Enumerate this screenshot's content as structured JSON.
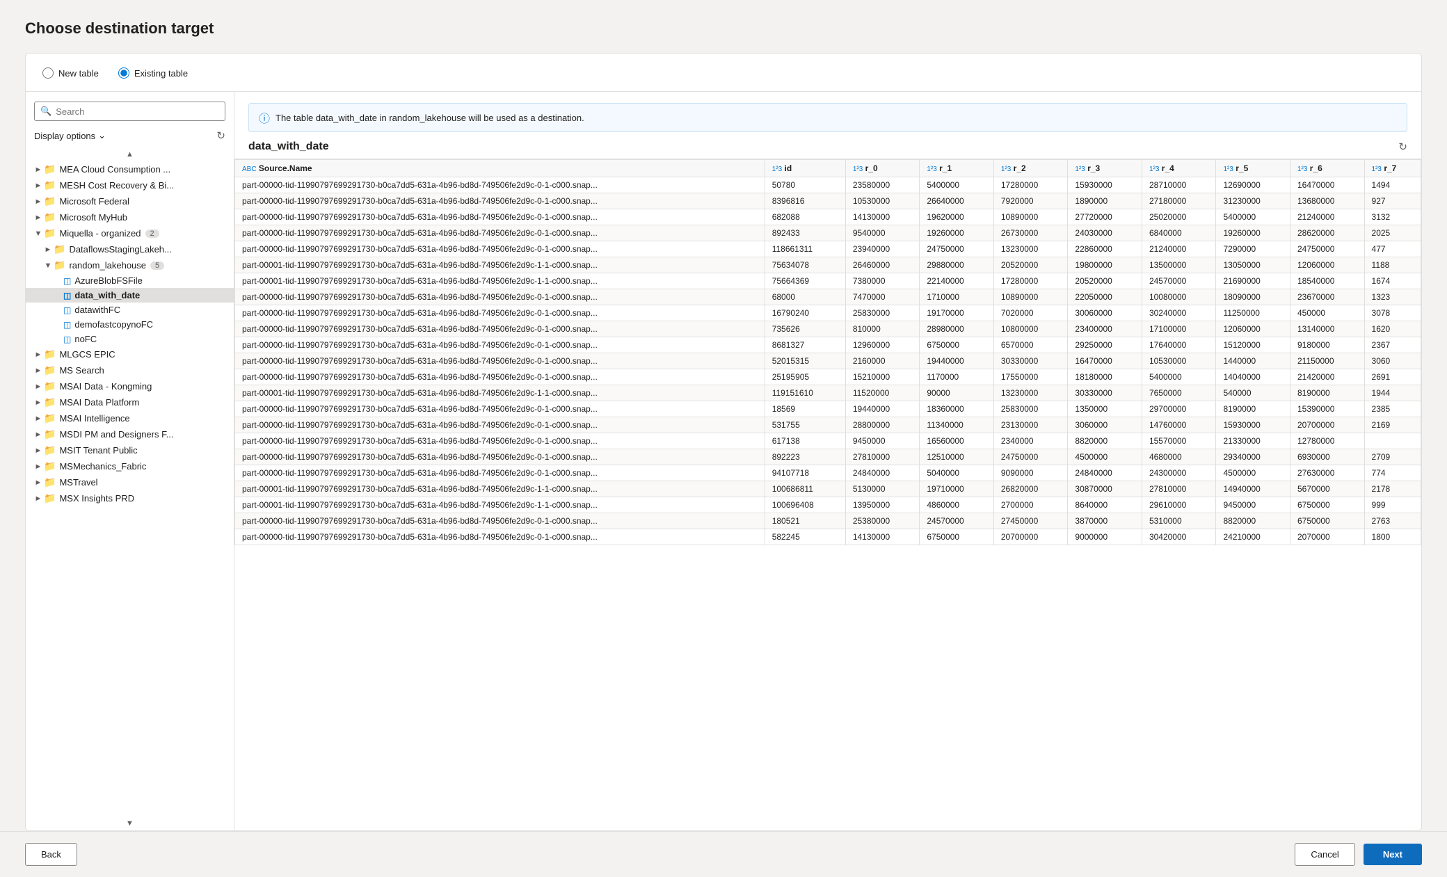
{
  "page": {
    "title": "Choose destination target"
  },
  "options": {
    "new_table_label": "New table",
    "existing_table_label": "Existing table"
  },
  "left": {
    "search_placeholder": "Search",
    "display_options_label": "Display options",
    "tree": [
      {
        "id": "mea",
        "label": "MEA Cloud Consumption ...",
        "level": 1,
        "type": "folder",
        "expanded": false,
        "badge": ""
      },
      {
        "id": "mesh",
        "label": "MESH Cost Recovery & Bi...",
        "level": 1,
        "type": "folder",
        "expanded": false,
        "badge": ""
      },
      {
        "id": "msfederal",
        "label": "Microsoft Federal",
        "level": 1,
        "type": "folder",
        "expanded": false,
        "badge": ""
      },
      {
        "id": "mymyhub",
        "label": "Microsoft MyHub",
        "level": 1,
        "type": "folder",
        "expanded": false,
        "badge": ""
      },
      {
        "id": "miquellaorg",
        "label": "Miquella - organized",
        "level": 1,
        "type": "folder",
        "expanded": true,
        "badge": "2"
      },
      {
        "id": "dataflows",
        "label": "DataflowsStagingLakeh...",
        "level": 2,
        "type": "folder",
        "expanded": false,
        "badge": ""
      },
      {
        "id": "randomlake",
        "label": "random_lakehouse",
        "level": 2,
        "type": "folder",
        "expanded": true,
        "badge": "5"
      },
      {
        "id": "azureblob",
        "label": "AzureBlobFSFile",
        "level": 3,
        "type": "table",
        "expanded": false,
        "badge": ""
      },
      {
        "id": "datawithdate",
        "label": "data_with_date",
        "level": 3,
        "type": "table",
        "expanded": false,
        "badge": "",
        "selected": true
      },
      {
        "id": "datawithfc",
        "label": "datawithFC",
        "level": 3,
        "type": "table",
        "expanded": false,
        "badge": ""
      },
      {
        "id": "demofastcopy",
        "label": "demofastcopynoFC",
        "level": 3,
        "type": "table",
        "expanded": false,
        "badge": ""
      },
      {
        "id": "nofc",
        "label": "noFC",
        "level": 3,
        "type": "table",
        "expanded": false,
        "badge": ""
      },
      {
        "id": "mlgcs",
        "label": "MLGCS EPIC",
        "level": 1,
        "type": "folder",
        "expanded": false,
        "badge": ""
      },
      {
        "id": "mssearch",
        "label": "MS Search",
        "level": 1,
        "type": "folder",
        "expanded": false,
        "badge": ""
      },
      {
        "id": "msaikongming",
        "label": "MSAI Data - Kongming",
        "level": 1,
        "type": "folder",
        "expanded": false,
        "badge": ""
      },
      {
        "id": "msaidataplatform",
        "label": "MSAI Data Platform",
        "level": 1,
        "type": "folder",
        "expanded": false,
        "badge": ""
      },
      {
        "id": "msaiintelligence",
        "label": "MSAI Intelligence",
        "level": 1,
        "type": "folder",
        "expanded": false,
        "badge": ""
      },
      {
        "id": "msdipm",
        "label": "MSDI PM and Designers F...",
        "level": 1,
        "type": "folder",
        "expanded": false,
        "badge": ""
      },
      {
        "id": "msittenant",
        "label": "MSIT Tenant Public",
        "level": 1,
        "type": "folder",
        "expanded": false,
        "badge": ""
      },
      {
        "id": "msmechanics",
        "label": "MSMechanics_Fabric",
        "level": 1,
        "type": "folder",
        "expanded": false,
        "badge": ""
      },
      {
        "id": "mstravel",
        "label": "MSTravel",
        "level": 1,
        "type": "folder",
        "expanded": false,
        "badge": ""
      },
      {
        "id": "msxinsights",
        "label": "MSX Insights PRD",
        "level": 1,
        "type": "folder",
        "expanded": false,
        "badge": ""
      }
    ]
  },
  "right": {
    "info_text": "The table data_with_date in random_lakehouse will be used as a destination.",
    "table_name": "data_with_date",
    "columns": [
      {
        "name": "Source.Name",
        "type": "ABC"
      },
      {
        "name": "id",
        "type": "1²3"
      },
      {
        "name": "r_0",
        "type": "1²3"
      },
      {
        "name": "r_1",
        "type": "1²3"
      },
      {
        "name": "r_2",
        "type": "1²3"
      },
      {
        "name": "r_3",
        "type": "1²3"
      },
      {
        "name": "r_4",
        "type": "1²3"
      },
      {
        "name": "r_5",
        "type": "1²3"
      },
      {
        "name": "r_6",
        "type": "1²3"
      },
      {
        "name": "r_7",
        "type": "1²3"
      }
    ],
    "rows": [
      [
        "part-00000-tid-11990797699291730-b0ca7dd5-631a-4b96-bd8d-749506fe2d9c-0-1-c000.snap...",
        "50780",
        "23580000",
        "5400000",
        "17280000",
        "15930000",
        "28710000",
        "12690000",
        "16470000",
        "1494"
      ],
      [
        "part-00000-tid-11990797699291730-b0ca7dd5-631a-4b96-bd8d-749506fe2d9c-0-1-c000.snap...",
        "8396816",
        "10530000",
        "26640000",
        "7920000",
        "1890000",
        "27180000",
        "31230000",
        "13680000",
        "927"
      ],
      [
        "part-00000-tid-11990797699291730-b0ca7dd5-631a-4b96-bd8d-749506fe2d9c-0-1-c000.snap...",
        "682088",
        "14130000",
        "19620000",
        "10890000",
        "27720000",
        "25020000",
        "5400000",
        "21240000",
        "3132"
      ],
      [
        "part-00000-tid-11990797699291730-b0ca7dd5-631a-4b96-bd8d-749506fe2d9c-0-1-c000.snap...",
        "892433",
        "9540000",
        "19260000",
        "26730000",
        "24030000",
        "6840000",
        "19260000",
        "28620000",
        "2025"
      ],
      [
        "part-00000-tid-11990797699291730-b0ca7dd5-631a-4b96-bd8d-749506fe2d9c-0-1-c000.snap...",
        "118661311",
        "23940000",
        "24750000",
        "13230000",
        "22860000",
        "21240000",
        "7290000",
        "24750000",
        "477"
      ],
      [
        "part-00001-tid-11990797699291730-b0ca7dd5-631a-4b96-bd8d-749506fe2d9c-1-1-c000.snap...",
        "75634078",
        "26460000",
        "29880000",
        "20520000",
        "19800000",
        "13500000",
        "13050000",
        "12060000",
        "1188"
      ],
      [
        "part-00001-tid-11990797699291730-b0ca7dd5-631a-4b96-bd8d-749506fe2d9c-1-1-c000.snap...",
        "75664369",
        "7380000",
        "22140000",
        "17280000",
        "20520000",
        "24570000",
        "21690000",
        "18540000",
        "1674"
      ],
      [
        "part-00000-tid-11990797699291730-b0ca7dd5-631a-4b96-bd8d-749506fe2d9c-0-1-c000.snap...",
        "68000",
        "7470000",
        "1710000",
        "10890000",
        "22050000",
        "10080000",
        "18090000",
        "23670000",
        "1323"
      ],
      [
        "part-00000-tid-11990797699291730-b0ca7dd5-631a-4b96-bd8d-749506fe2d9c-0-1-c000.snap...",
        "16790240",
        "25830000",
        "19170000",
        "7020000",
        "30060000",
        "30240000",
        "11250000",
        "450000",
        "3078"
      ],
      [
        "part-00000-tid-11990797699291730-b0ca7dd5-631a-4b96-bd8d-749506fe2d9c-0-1-c000.snap...",
        "735626",
        "810000",
        "28980000",
        "10800000",
        "23400000",
        "17100000",
        "12060000",
        "13140000",
        "1620"
      ],
      [
        "part-00000-tid-11990797699291730-b0ca7dd5-631a-4b96-bd8d-749506fe2d9c-0-1-c000.snap...",
        "8681327",
        "12960000",
        "6750000",
        "6570000",
        "29250000",
        "17640000",
        "15120000",
        "9180000",
        "2367"
      ],
      [
        "part-00000-tid-11990797699291730-b0ca7dd5-631a-4b96-bd8d-749506fe2d9c-0-1-c000.snap...",
        "52015315",
        "2160000",
        "19440000",
        "30330000",
        "16470000",
        "10530000",
        "1440000",
        "21150000",
        "3060"
      ],
      [
        "part-00000-tid-11990797699291730-b0ca7dd5-631a-4b96-bd8d-749506fe2d9c-0-1-c000.snap...",
        "25195905",
        "15210000",
        "1170000",
        "17550000",
        "18180000",
        "5400000",
        "14040000",
        "21420000",
        "2691"
      ],
      [
        "part-00001-tid-11990797699291730-b0ca7dd5-631a-4b96-bd8d-749506fe2d9c-1-1-c000.snap...",
        "119151610",
        "11520000",
        "90000",
        "13230000",
        "30330000",
        "7650000",
        "540000",
        "8190000",
        "1944"
      ],
      [
        "part-00000-tid-11990797699291730-b0ca7dd5-631a-4b96-bd8d-749506fe2d9c-0-1-c000.snap...",
        "18569",
        "19440000",
        "18360000",
        "25830000",
        "1350000",
        "29700000",
        "8190000",
        "15390000",
        "2385"
      ],
      [
        "part-00000-tid-11990797699291730-b0ca7dd5-631a-4b96-bd8d-749506fe2d9c-0-1-c000.snap...",
        "531755",
        "28800000",
        "11340000",
        "23130000",
        "3060000",
        "14760000",
        "15930000",
        "20700000",
        "2169"
      ],
      [
        "part-00000-tid-11990797699291730-b0ca7dd5-631a-4b96-bd8d-749506fe2d9c-0-1-c000.snap...",
        "617138",
        "9450000",
        "16560000",
        "2340000",
        "8820000",
        "15570000",
        "21330000",
        "12780000",
        ""
      ],
      [
        "part-00000-tid-11990797699291730-b0ca7dd5-631a-4b96-bd8d-749506fe2d9c-0-1-c000.snap...",
        "892223",
        "27810000",
        "12510000",
        "24750000",
        "4500000",
        "4680000",
        "29340000",
        "6930000",
        "2709"
      ],
      [
        "part-00000-tid-11990797699291730-b0ca7dd5-631a-4b96-bd8d-749506fe2d9c-0-1-c000.snap...",
        "94107718",
        "24840000",
        "5040000",
        "9090000",
        "24840000",
        "24300000",
        "4500000",
        "27630000",
        "774"
      ],
      [
        "part-00001-tid-11990797699291730-b0ca7dd5-631a-4b96-bd8d-749506fe2d9c-1-1-c000.snap...",
        "100686811",
        "5130000",
        "19710000",
        "26820000",
        "30870000",
        "27810000",
        "14940000",
        "5670000",
        "2178"
      ],
      [
        "part-00001-tid-11990797699291730-b0ca7dd5-631a-4b96-bd8d-749506fe2d9c-1-1-c000.snap...",
        "100696408",
        "13950000",
        "4860000",
        "2700000",
        "8640000",
        "29610000",
        "9450000",
        "6750000",
        "999"
      ],
      [
        "part-00000-tid-11990797699291730-b0ca7dd5-631a-4b96-bd8d-749506fe2d9c-0-1-c000.snap...",
        "180521",
        "25380000",
        "24570000",
        "27450000",
        "3870000",
        "5310000",
        "8820000",
        "6750000",
        "2763"
      ],
      [
        "part-00000-tid-11990797699291730-b0ca7dd5-631a-4b96-bd8d-749506fe2d9c-0-1-c000.snap...",
        "582245",
        "14130000",
        "6750000",
        "20700000",
        "9000000",
        "30420000",
        "24210000",
        "2070000",
        "1800"
      ]
    ]
  },
  "footer": {
    "back_label": "Back",
    "cancel_label": "Cancel",
    "next_label": "Next"
  }
}
